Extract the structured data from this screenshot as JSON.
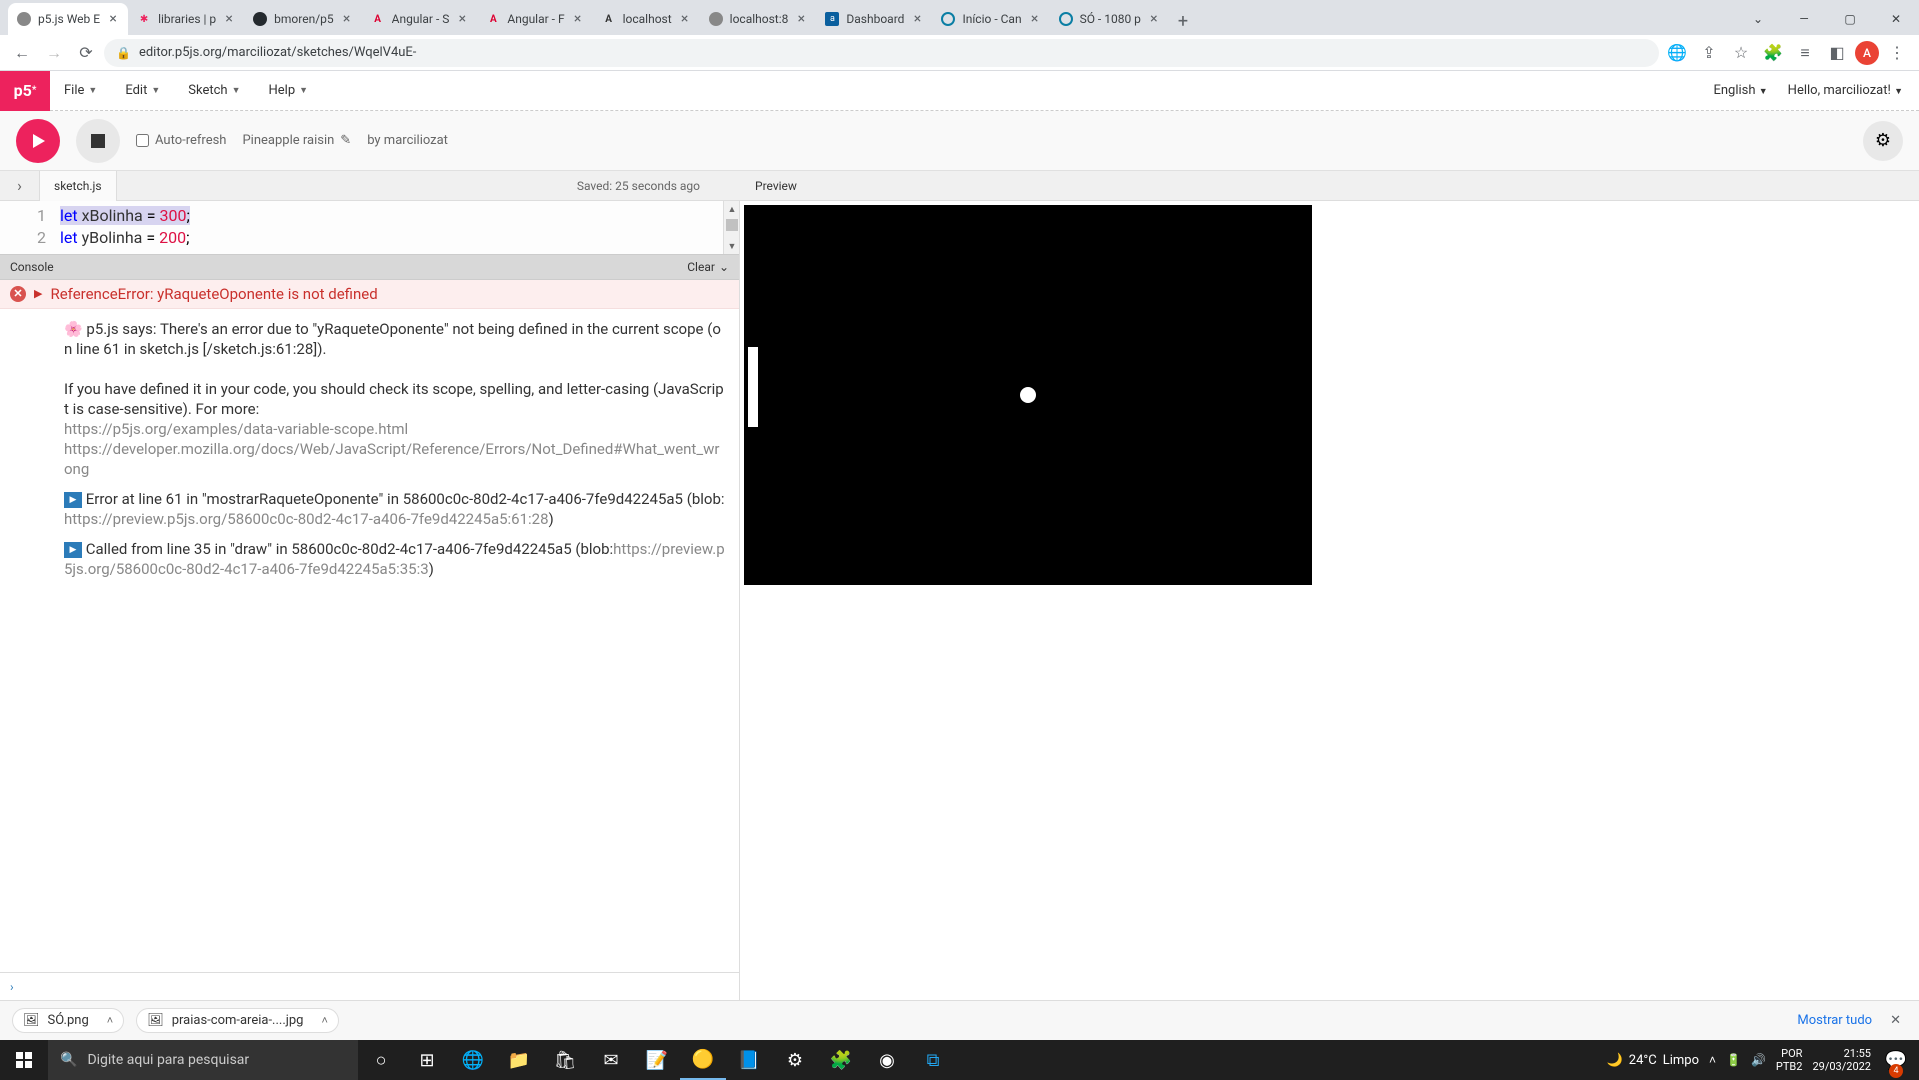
{
  "browser": {
    "tabs": [
      {
        "title": "p5.js Web E",
        "fav": "p5"
      },
      {
        "title": "libraries | p",
        "fav": "star"
      },
      {
        "title": "bmoren/p5",
        "fav": "gh"
      },
      {
        "title": "Angular - S",
        "fav": "ang"
      },
      {
        "title": "Angular - F",
        "fav": "ang"
      },
      {
        "title": "localhost",
        "fav": "ang2"
      },
      {
        "title": "localhost:8",
        "fav": "gray"
      },
      {
        "title": "Dashboard",
        "fav": "cur"
      },
      {
        "title": "Início - Can",
        "fav": "c"
      },
      {
        "title": "SÓ - 1080 p",
        "fav": "c"
      }
    ],
    "url": "editor.p5js.org/marciliozat/sketches/WqelV4uE-",
    "profile_initial": "A"
  },
  "p5": {
    "menu": {
      "file": "File",
      "edit": "Edit",
      "sketch": "Sketch",
      "help": "Help"
    },
    "lang": "English",
    "hello": "Hello, marciliozat!",
    "auto_refresh": "Auto-refresh",
    "sketch_name": "Pineapple raisin",
    "byline": "by marciliozat",
    "file_tab": "sketch.js",
    "saved": "Saved: 25 seconds ago",
    "preview": "Preview",
    "code": {
      "l1_kw": "let",
      "l1_var": "xBolinha",
      "l1_eq": " = ",
      "l1_num": "300",
      "l1_end": ";",
      "l2_kw": "let",
      "l2_var": "yBolinha",
      "l2_eq": " = ",
      "l2_num": "200",
      "l2_end": ";"
    },
    "console": {
      "title": "Console",
      "clear": "Clear",
      "error": "ReferenceError: yRaqueteOponente is not defined",
      "msg1a": "p5.js says: There's an error due to \"yRaqueteOponente\" not being defined in the current scope (on line 61 in sketch.js [/sketch.js:61:28]).",
      "msg1b": "If you have defined it in your code, you should check its scope, spelling, and letter-casing (JavaScript is case-sensitive). For more:",
      "link1": "https://p5js.org/examples/data-variable-scope.html",
      "link2": "https://developer.mozilla.org/docs/Web/JavaScript/Reference/Errors/Not_Defined#What_went_wrong",
      "msg2a": " Error at line 61 in \"mostrarRaqueteOponente\" in 58600c0c-80d2-4c17-a406-7fe9d42245a5 (blob:",
      "link3": "https://preview.p5js.org/58600c0c-80d2-4c17-a406-7fe9d42245a5:61:28",
      "msg2b": ")",
      "msg3a": " Called from line 35 in \"draw\" in 58600c0c-80d2-4c17-a406-7fe9d42245a5 (blob:",
      "link4": "https://preview.p5js.org/58600c0c-80d2-4c17-a406-7fe9d42245a5:35:3",
      "msg3b": ")"
    }
  },
  "downloads": {
    "items": [
      "SÓ.png",
      "praias-com-areia-....jpg"
    ],
    "show_all": "Mostrar tudo"
  },
  "taskbar": {
    "search_placeholder": "Digite aqui para pesquisar",
    "weather_temp": "24°C",
    "weather_cond": "Limpo",
    "lang1": "POR",
    "lang2": "PTB2",
    "time": "21:55",
    "date": "29/03/2022",
    "notif": "4"
  }
}
